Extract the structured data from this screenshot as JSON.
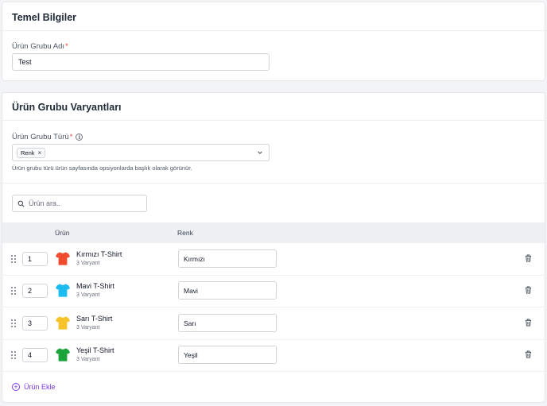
{
  "basic": {
    "title": "Temel Bilgiler",
    "group_name_label": "Ürün Grubu Adı",
    "required_mark": "*",
    "group_name_value": "Test"
  },
  "variants": {
    "title": "Ürün Grubu Varyantları",
    "type_label": "Ürün Grubu Türü",
    "required_mark": "*",
    "type_tag": "Renk",
    "tag_remove": "×",
    "help_text": "Ürün grubu türü ürün sayfasında opsiyonlarda başlık olarak görünür.",
    "search_placeholder": "Ürün ara..",
    "columns": {
      "product": "Ürün",
      "color": "Renk"
    },
    "rows": [
      {
        "order": "1",
        "name": "Kırmızı T-Shirt",
        "variants": "3 Varyant",
        "color_value": "Kırmızı",
        "shirt_color": "#f04b2f"
      },
      {
        "order": "2",
        "name": "Mavi T-Shirt",
        "variants": "3 Varyant",
        "color_value": "Mavi",
        "shirt_color": "#1cbcf0"
      },
      {
        "order": "3",
        "name": "Sarı T-Shirt",
        "variants": "3 Varyant",
        "color_value": "Sarı",
        "shirt_color": "#f7c32a"
      },
      {
        "order": "4",
        "name": "Yeşil T-Shirt",
        "variants": "3 Varyant",
        "color_value": "Yeşil",
        "shirt_color": "#1aa33a"
      }
    ],
    "add_button": "Ürün Ekle"
  },
  "colors": {
    "accent": "#7c3aed",
    "required": "#ef4444"
  },
  "icons": {
    "info": "info-icon",
    "chevron": "chevron-down-icon",
    "search": "search-icon",
    "drag": "drag-handle-icon",
    "trash": "trash-icon",
    "add": "plus-circle-icon"
  }
}
